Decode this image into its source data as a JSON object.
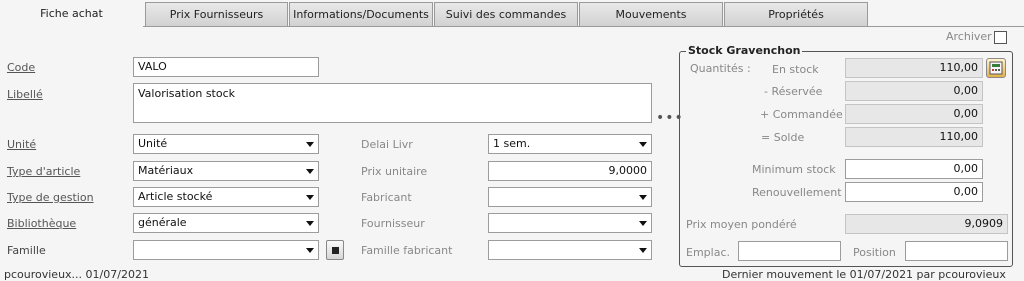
{
  "tabs": [
    {
      "label": "Fiche achat",
      "active": true
    },
    {
      "label": "Prix Fournisseurs"
    },
    {
      "label": "Informations/Documents"
    },
    {
      "label": "Suivi des commandes"
    },
    {
      "label": "Mouvements"
    },
    {
      "label": "Propriétés"
    }
  ],
  "archive_label": "Archiver",
  "form": {
    "code_label": "Code",
    "code_value": "VALO",
    "libelle_label": "Libellé",
    "libelle_value": "Valorisation stock",
    "unite_label": "Unité",
    "unite_value": "Unité",
    "type_article_label": "Type d'article",
    "type_article_value": "Matériaux",
    "type_gestion_label": "Type de gestion",
    "type_gestion_value": "Article stocké",
    "bibliotheque_label": "Bibliothèque",
    "bibliotheque_value": "générale",
    "famille_label": "Famille",
    "famille_value": "",
    "delai_label": "Delai Livr",
    "delai_value": "1 sem.",
    "prix_unitaire_label": "Prix unitaire",
    "prix_unitaire_value": "9,0000",
    "fabricant_label": "Fabricant",
    "fabricant_value": "",
    "fournisseur_label": "Fournisseur",
    "fournisseur_value": "",
    "famille_fabricant_label": "Famille fabricant",
    "famille_fabricant_value": ""
  },
  "stock": {
    "title": "Stock Gravenchon",
    "quantites_label": "Quantités :",
    "en_stock_label": "En stock",
    "en_stock_value": "110,00",
    "reservee_label": "- Réservée",
    "reservee_value": "0,00",
    "commandee_label": "+ Commandée",
    "commandee_value": "0,00",
    "solde_label": "= Solde",
    "solde_value": "110,00",
    "minimum_label": "Minimum stock",
    "minimum_value": "0,00",
    "renouvellement_label": "Renouvellement",
    "renouvellement_value": "0,00",
    "prix_moyen_label": "Prix moyen pondéré",
    "prix_moyen_value": "9,0909",
    "emplac_label": "Emplac.",
    "emplac_value": "",
    "position_label": "Position",
    "position_value": ""
  },
  "footer": {
    "left": "pcourovieux... 01/07/2021",
    "right": "Dernier mouvement le 01/07/2021 par pcourovieux"
  }
}
